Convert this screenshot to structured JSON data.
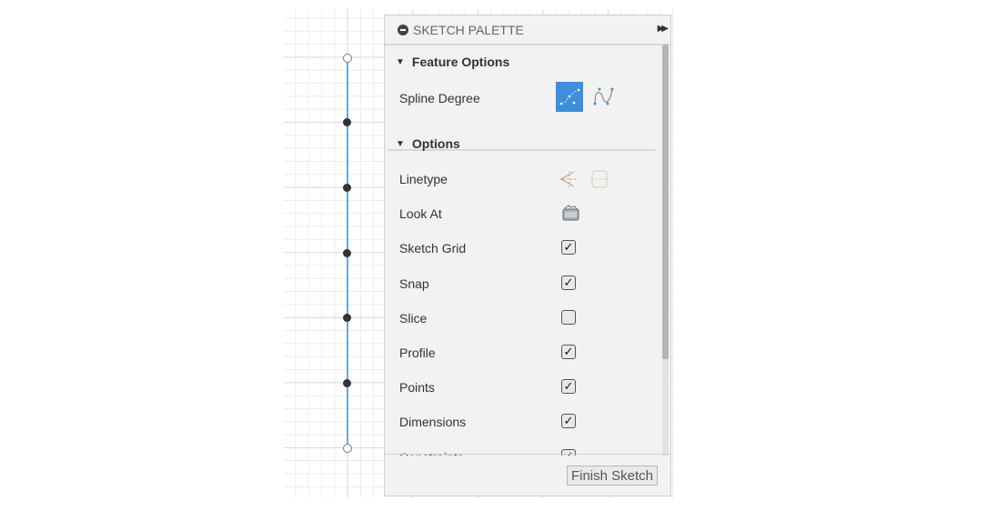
{
  "palette": {
    "title": "SKETCH PALETTE",
    "feature_options": {
      "title": "Feature Options",
      "spline_degree_label": "Spline Degree",
      "spline_selected": "fit-point-spline"
    },
    "options": {
      "title": "Options",
      "rows": [
        {
          "label": "Linetype",
          "type": "icons"
        },
        {
          "label": "Look At",
          "type": "icon"
        },
        {
          "label": "Sketch Grid",
          "checked": true
        },
        {
          "label": "Snap",
          "checked": true
        },
        {
          "label": "Slice",
          "checked": false
        },
        {
          "label": "Profile",
          "checked": true
        },
        {
          "label": "Points",
          "checked": true
        },
        {
          "label": "Dimensions",
          "checked": true
        },
        {
          "label": "Constraints",
          "checked": true
        }
      ]
    },
    "finish_label": "Finish Sketch"
  },
  "colors": {
    "accent": "#3d8fdc",
    "axis": "#6aa7d8"
  }
}
